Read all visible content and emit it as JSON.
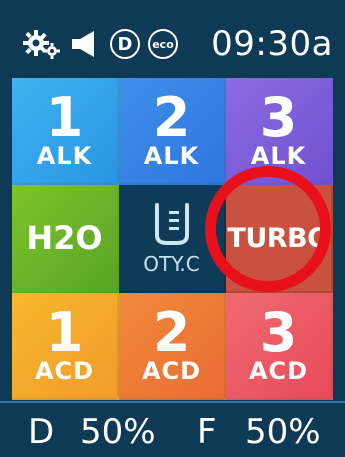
{
  "status": {
    "time": "09:30a",
    "icons": [
      "gear-icon",
      "speaker-icon",
      "d-mode-icon",
      "eco-icon"
    ],
    "d_glyph": "D",
    "eco_text": "eco"
  },
  "tiles": [
    {
      "num": "1",
      "label": "ALK"
    },
    {
      "num": "2",
      "label": "ALK"
    },
    {
      "num": "3",
      "label": "ALK"
    },
    {
      "label": "H2O"
    },
    {
      "label": "OTY.C"
    },
    {
      "label": "TURBO"
    },
    {
      "num": "1",
      "label": "ACD"
    },
    {
      "num": "2",
      "label": "ACD"
    },
    {
      "num": "3",
      "label": "ACD"
    }
  ],
  "bottom": {
    "d_label": "D",
    "d_value": "50%",
    "f_label": "F",
    "f_value": "50%"
  },
  "colors": {
    "background": "#0f3a55",
    "highlight_ring": "#e8101a"
  }
}
